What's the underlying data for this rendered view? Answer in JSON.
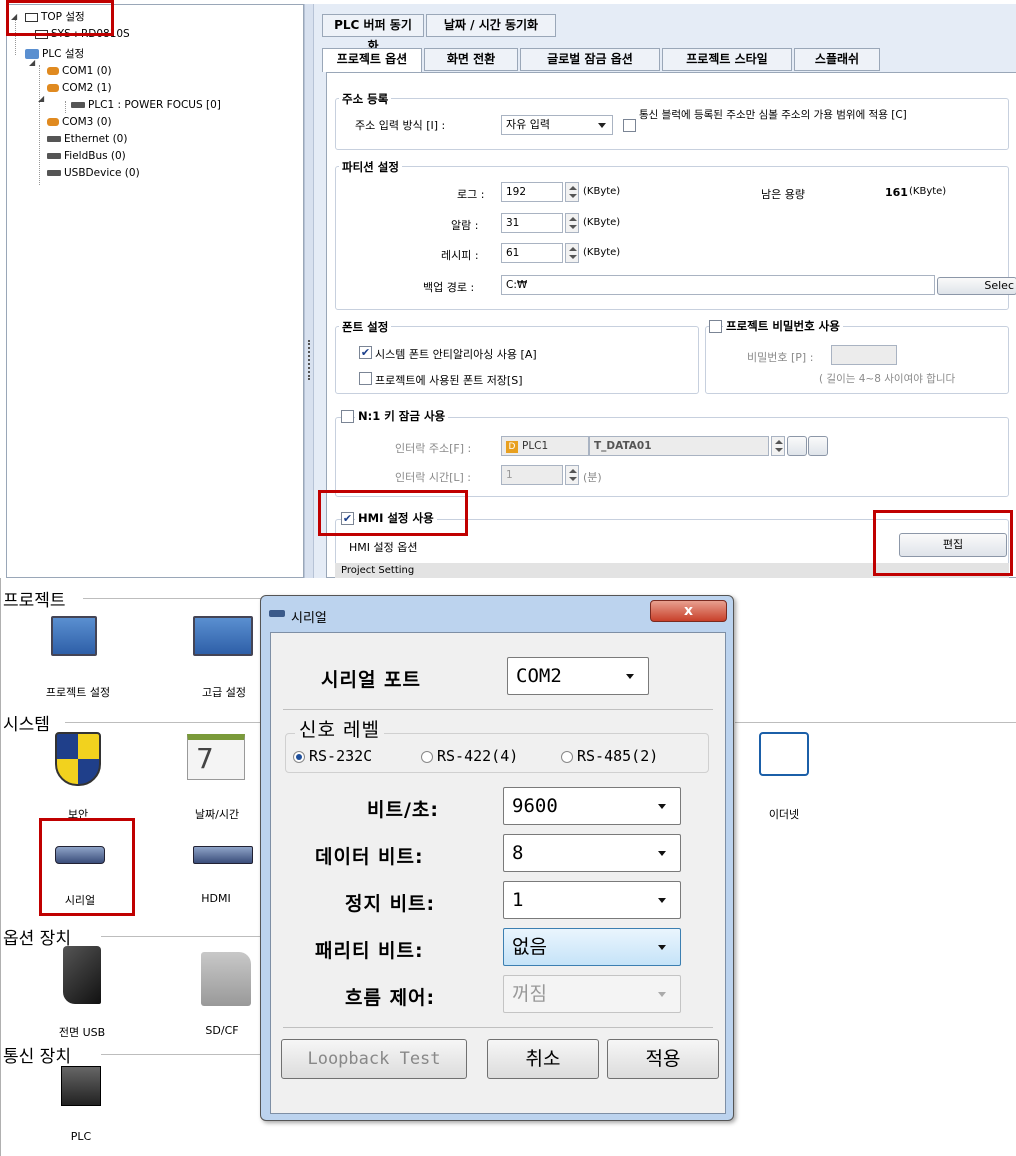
{
  "tree": {
    "items": [
      {
        "label": "TOP 설정"
      },
      {
        "label": "SYS : RD0810S"
      },
      {
        "label": "PLC 설정"
      },
      {
        "label": "COM1 (0)"
      },
      {
        "label": "COM2 (1)"
      },
      {
        "label": "PLC1 : POWER FOCUS [0]"
      },
      {
        "label": "COM3 (0)"
      },
      {
        "label": "Ethernet (0)"
      },
      {
        "label": "FieldBus (0)"
      },
      {
        "label": "USBDevice (0)"
      }
    ]
  },
  "tabs_row1": [
    "PLC 버퍼 동기화",
    "날짜 / 시간 동기화"
  ],
  "tabs_row2": [
    "프로젝트 옵션",
    "화면 전환",
    "글로벌 잠금 옵션",
    "프로젝트 스타일",
    "스플래쉬"
  ],
  "address": {
    "title": "주소 등록",
    "method_label": "주소 입력 방식 [I] :",
    "method_value": "자유 입력",
    "scope_label": "통신 블럭에 등록된 주소만 심볼 주소의 가용 범위에 적용 [C]",
    "scope_checked": false
  },
  "partition": {
    "title": "파티션 설정",
    "log_label": "로그 :",
    "log_value": "192",
    "alarm_label": "알람 :",
    "alarm_value": "31",
    "recipe_label": "레시피 :",
    "recipe_value": "61",
    "unit": "(KByte)",
    "remain_label": "남은 용량",
    "remain_value": "161",
    "remain_unit": "(KByte)",
    "backup_label": "백업 경로 :",
    "backup_value": "C:₩",
    "select_label": "Selec"
  },
  "font": {
    "title": "폰트 설정",
    "antialias_label": "시스템 폰트 안티알리아싱 사용 [A]",
    "antialias_checked": true,
    "save_label": "프로젝트에 사용된 폰트 저장[S]",
    "save_checked": false
  },
  "password": {
    "title": "프로젝트 비밀번호 사용",
    "checked": false,
    "pw_label": "비밀번호 [P] :",
    "hint": "( 길이는 4~8 사이여야 합니다"
  },
  "lock": {
    "title": "N:1 키 잠금 사용",
    "checked": false,
    "addr_label": "인터락 주소[F] :",
    "plc": "PLC1",
    "addr_value": "T_DATA01",
    "time_label": "인터락 시간[L] :",
    "time_value": "1",
    "time_unit": "(분)"
  },
  "hmi": {
    "title": "HMI 설정 사용",
    "checked": true,
    "option_label": "HMI 설정 옵션",
    "edit_label": "편집",
    "project_setting": "Project Setting"
  },
  "settings": {
    "sec_project": "프로젝트",
    "sec_system": "시스템",
    "sec_option": "옵션 장치",
    "sec_comm": "통신 장치",
    "items": {
      "project_setting": "프로젝트 설정",
      "advanced": "고급 설정",
      "security": "보안",
      "datetime": "날짜/시간",
      "serial": "시리얼",
      "hdmi": "HDMI",
      "ethernet": "이더넷",
      "front_usb": "전면 USB",
      "sdcf": "SD/CF",
      "plc": "PLC"
    }
  },
  "dialog": {
    "title": "시리얼",
    "close": "x",
    "port_label": "시리얼 포트",
    "port_value": "COM2",
    "signal_label": "신호 레벨",
    "signal_options": [
      "RS-232C",
      "RS-422(4)",
      "RS-485(2)"
    ],
    "signal_selected": 0,
    "baud_label": "비트/초:",
    "baud_value": "9600",
    "data_label": "데이터 비트:",
    "data_value": "8",
    "stop_label": "정지 비트:",
    "stop_value": "1",
    "parity_label": "패리티 비트:",
    "parity_value": "없음",
    "flow_label": "흐름 제어:",
    "flow_value": "꺼짐",
    "loopback": "Loopback Test",
    "cancel": "취소",
    "apply": "적용"
  },
  "colors": {
    "highlight": "#c00000",
    "accent": "#1e4f9b"
  }
}
